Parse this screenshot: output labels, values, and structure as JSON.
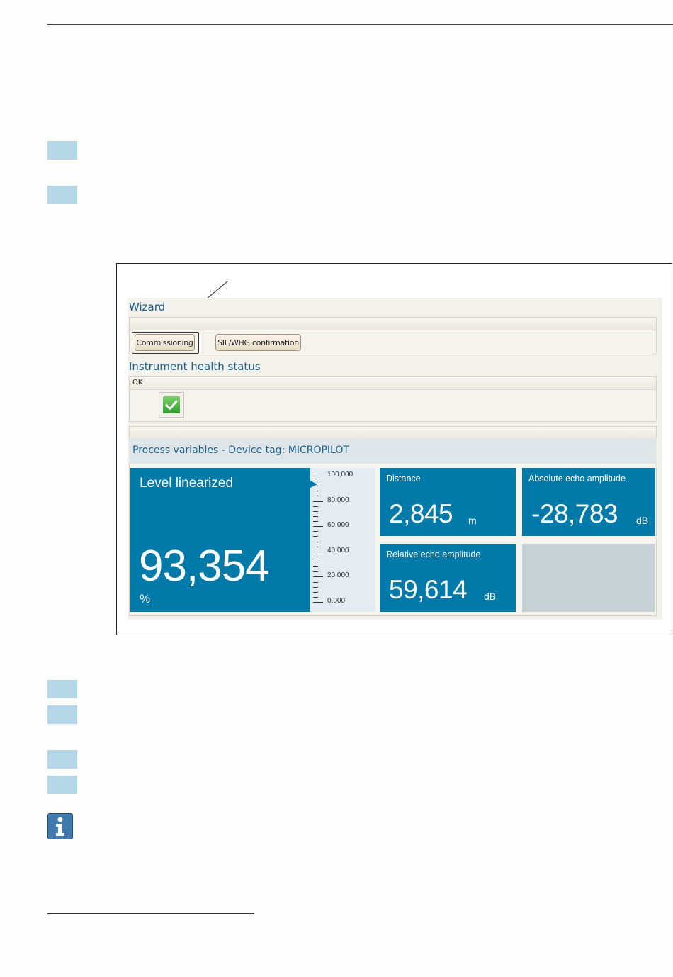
{
  "wizard": {
    "title": "Wizard",
    "buttons": [
      "Commissioning",
      "SIL/WHG confirmation"
    ]
  },
  "health": {
    "title": "Instrument health status",
    "status": "OK"
  },
  "process": {
    "title": "Process variables - Device tag: MICROPILOT",
    "level": {
      "label": "Level linearized",
      "value": "93,354",
      "unit": "%",
      "level_percent": 93.354
    },
    "scale_labels": [
      "100,000",
      "80,000",
      "60,000",
      "40,000",
      "20,000",
      "0,000"
    ],
    "distance": {
      "label": "Distance",
      "value": "2,845",
      "unit": "m"
    },
    "absolute_echo": {
      "label": "Absolute echo amplitude",
      "value": "-28,783",
      "unit": "dB"
    },
    "relative_echo": {
      "label": "Relative echo amplitude",
      "value": "59,614",
      "unit": "dB"
    }
  },
  "colors": {
    "tile": "#0179a9",
    "section_title": "#1c5f8c",
    "step_marker": "#b5d6e6"
  },
  "icons": [
    "checkmark-icon",
    "info-icon"
  ]
}
